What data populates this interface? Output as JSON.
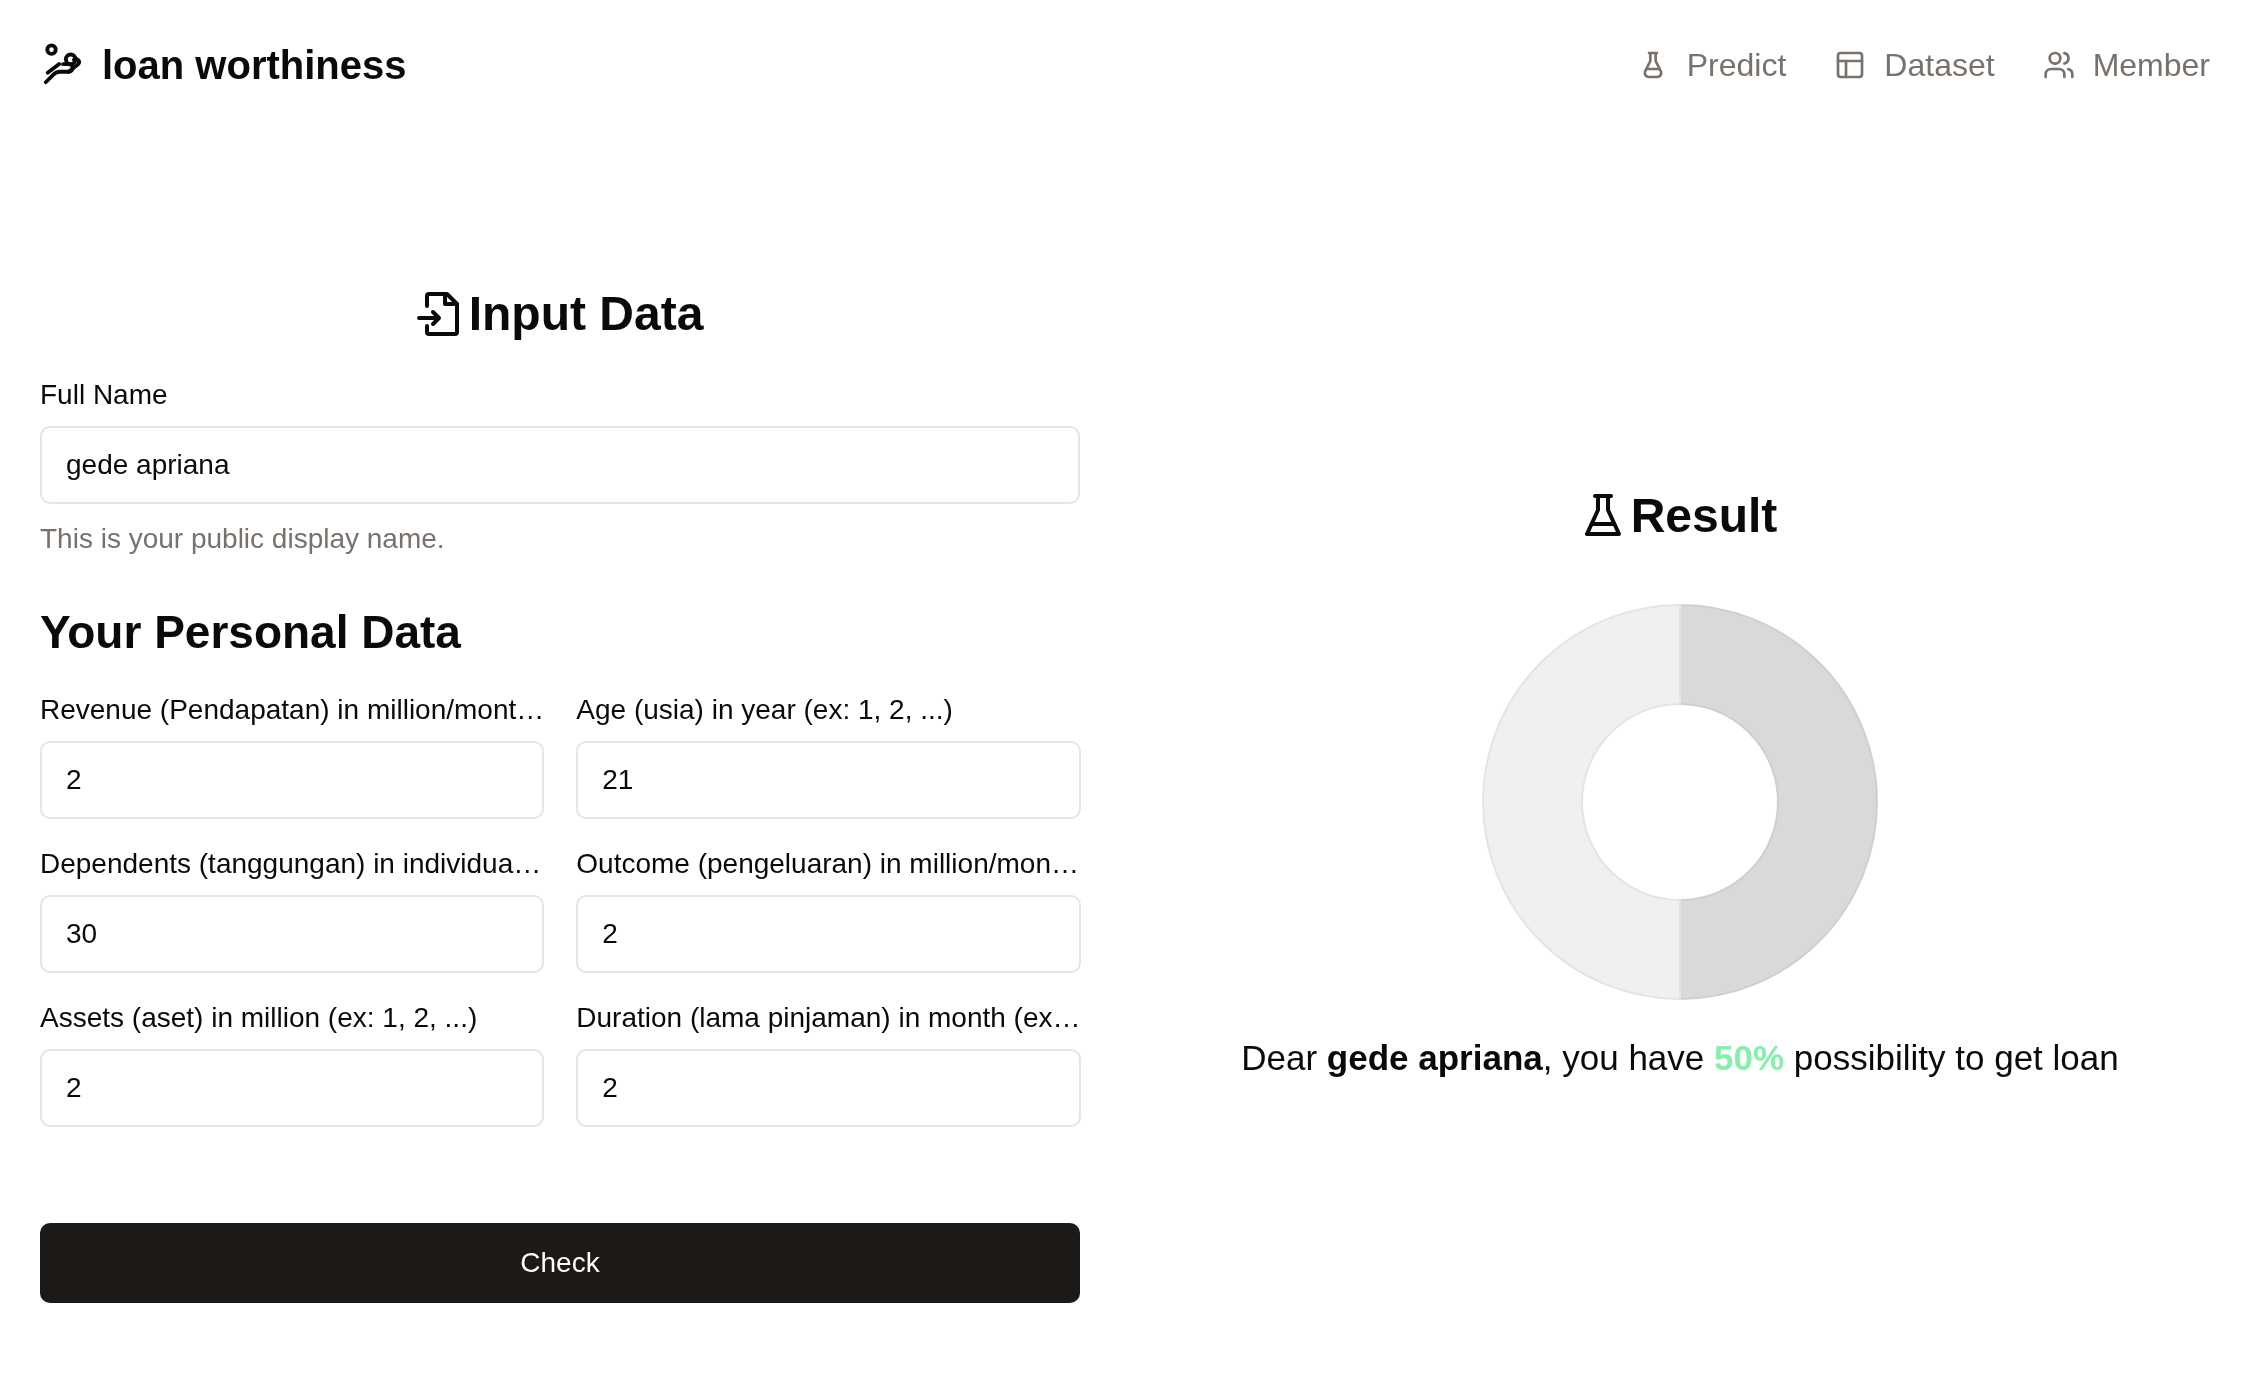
{
  "brand": {
    "title": "loan worthiness"
  },
  "nav": [
    {
      "label": "Predict"
    },
    {
      "label": "Dataset"
    },
    {
      "label": "Member"
    }
  ],
  "form": {
    "title": "Input Data",
    "name_label": "Full Name",
    "name_value": "gede apriana",
    "name_help": "This is your public display name.",
    "section_title": "Your Personal Data",
    "fields": [
      {
        "label": "Revenue (Pendapatan) in million/mont…",
        "value": "2"
      },
      {
        "label": "Age (usia) in year (ex: 1, 2, ...)",
        "value": "21"
      },
      {
        "label": "Dependents (tanggungan) in individua…",
        "value": "30"
      },
      {
        "label": "Outcome (pengeluaran) in million/mon…",
        "value": "2"
      },
      {
        "label": "Assets (aset) in million (ex: 1, 2, ...)",
        "value": "2"
      },
      {
        "label": "Duration (lama pinjaman) in month (ex…",
        "value": "2"
      }
    ],
    "button": "Check"
  },
  "result": {
    "title": "Result",
    "sentence": [
      {
        "text": "Dear ",
        "kind": "plain"
      },
      {
        "text": "gede apriana",
        "kind": "bold"
      },
      {
        "text": ", you have ",
        "kind": "plain"
      },
      {
        "text": "50%",
        "kind": "highlight"
      },
      {
        "text": " possibility to get loan",
        "kind": "plain"
      }
    ]
  }
}
